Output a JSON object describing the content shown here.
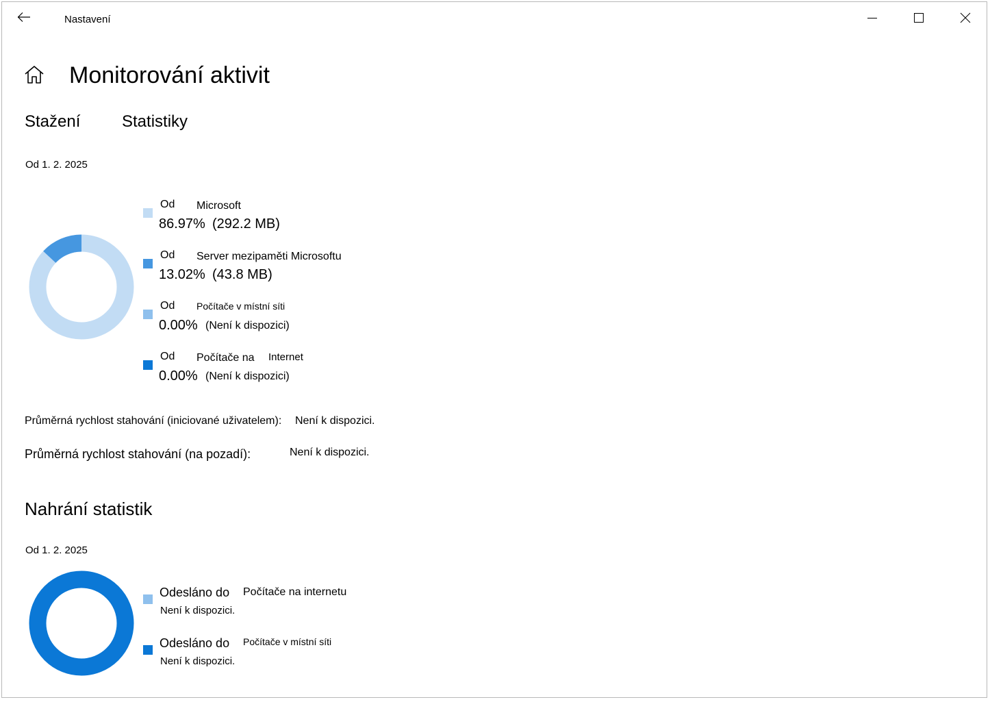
{
  "window": {
    "title": "Nastavení",
    "back_icon": "arrow-left-icon",
    "minimize_icon": "minimize-icon",
    "maximize_icon": "maximize-icon",
    "close_icon": "close-icon"
  },
  "header": {
    "home_icon": "home-icon",
    "title": "Monitorování aktivit"
  },
  "tabs": [
    {
      "label": "Stažení"
    },
    {
      "label": "Statistiky"
    }
  ],
  "download": {
    "since": "Od 1. 2. 2025",
    "legend": [
      {
        "prefix": "Od",
        "source": "Microsoft",
        "percent": "86.97%",
        "size": "(292.2 MB)",
        "color": "#c2dcf4",
        "fraction": 0.8697
      },
      {
        "prefix": "Od",
        "source": "Server mezipaměti Microsoftu",
        "percent": "13.02%",
        "size": "(43.8 MB)",
        "color": "#4697e0",
        "fraction": 0.1302
      },
      {
        "prefix": "Od",
        "source": "Počítače v místní síti",
        "percent": "0.00%",
        "size": "(Není k dispozici)",
        "color": "#8fc0ed",
        "fraction": 0
      },
      {
        "prefix": "Od",
        "source_a": "Počítače na",
        "source_b": "Internet",
        "percent": "0.00%",
        "size": "(Není k dispozici)",
        "color": "#0b78d6",
        "fraction": 0
      }
    ],
    "avg_user_label": "Průměrná rychlost stahování (iniciované uživatelem):",
    "avg_user_value": "Není k dispozici.",
    "avg_bg_label": "Průměrná rychlost stahování (na pozadí):",
    "avg_bg_value": "Není k dispozici."
  },
  "upload": {
    "title": "Nahrání statistik",
    "since": "Od 1. 2. 2025",
    "legend": [
      {
        "prefix": "Odesláno do",
        "target": "Počítače na internetu",
        "value": "Není k dispozici.",
        "color": "#8fc0ed"
      },
      {
        "prefix": "Odesláno do",
        "target": "Počítače v místní síti",
        "value": "Není k dispozici.",
        "color": "#0b78d6"
      }
    ],
    "ring_color": "#0b78d6"
  }
}
